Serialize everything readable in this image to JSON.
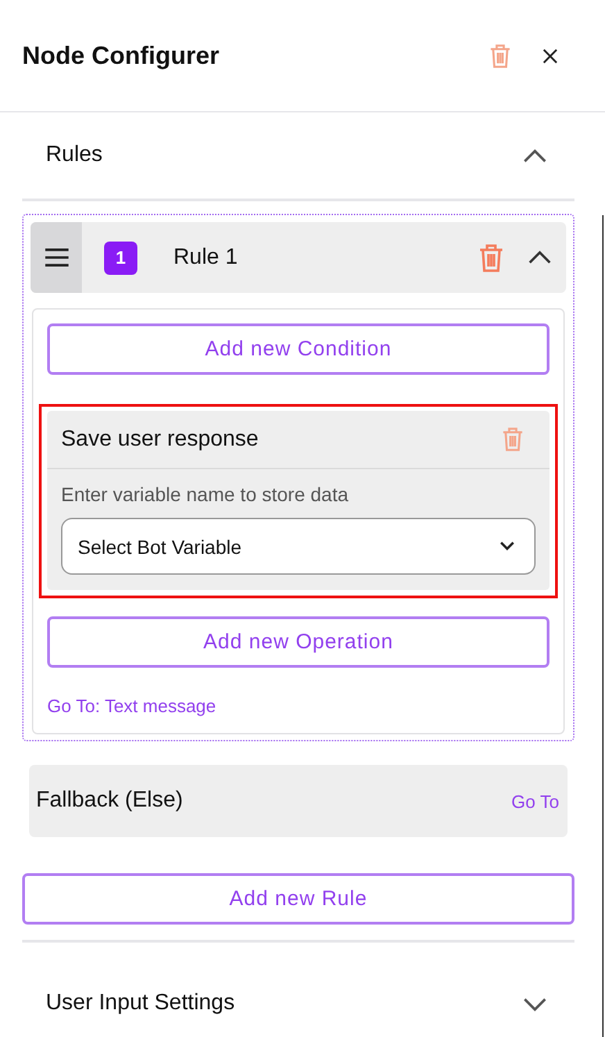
{
  "panel": {
    "title": "Node Configurer"
  },
  "rules_section": {
    "title": "Rules",
    "expanded": true,
    "rules": [
      {
        "number": "1",
        "title": "Rule 1",
        "expanded": true,
        "add_condition_button": "Add new Condition",
        "operations": [
          {
            "title": "Save user response",
            "highlighted": true,
            "field_label": "Enter variable name to store data",
            "select": {
              "value": "Select Bot Variable"
            }
          }
        ],
        "add_operation_button": "Add new Operation",
        "goto_link": "Go To: Text message"
      }
    ],
    "fallback": {
      "title": "Fallback (Else)",
      "goto_link": "Go To"
    },
    "add_rule_button": "Add new Rule"
  },
  "settings_section": {
    "title": "User Input Settings",
    "expanded": false
  }
}
